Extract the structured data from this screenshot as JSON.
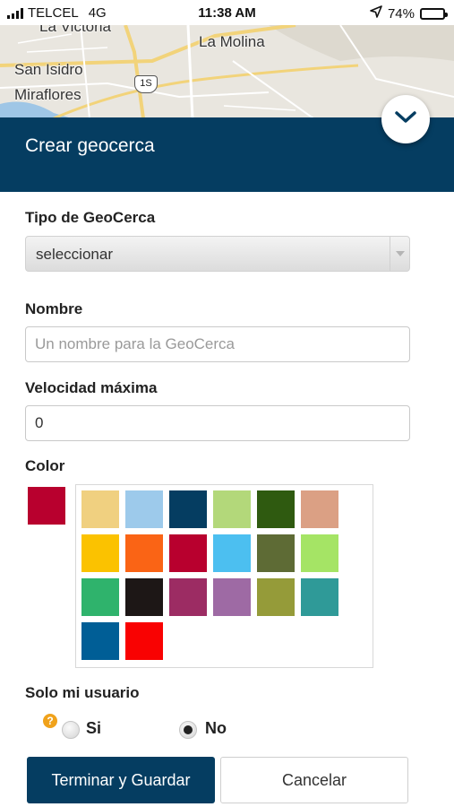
{
  "status": {
    "carrier": "TELCEL",
    "network": "4G",
    "time": "11:38 AM",
    "battery": "74%",
    "battery_level": 0.74
  },
  "map": {
    "labels": [
      "La Victoria",
      "La Molina",
      "San Isidro",
      "Miraflores",
      "1S"
    ]
  },
  "header": {
    "title": "Crear geocerca"
  },
  "form": {
    "tipo_label": "Tipo de GeoCerca",
    "tipo_value": "seleccionar",
    "nombre_label": "Nombre",
    "nombre_placeholder": "Un nombre para la GeoCerca",
    "nombre_value": "",
    "velocidad_label": "Velocidad máxima",
    "velocidad_value": "0",
    "color_label": "Color",
    "selected_color": "#b8002e",
    "palette": [
      "#f0d080",
      "#9dcaeb",
      "#053d61",
      "#b3d87a",
      "#2f5a10",
      "#dba084",
      "#fbc200",
      "#fa6415",
      "#b8002e",
      "#4cbff0",
      "#5e6b35",
      "#a5e465",
      "#2fb36c",
      "#1d1716",
      "#9c2c63",
      "#9e6aa4",
      "#959b39",
      "#2f9a98",
      "#005e96",
      "#f90202"
    ],
    "solo_label": "Solo mi usuario",
    "help_icon": "?",
    "option_si": "Si",
    "option_no": "No",
    "selected_option": "No"
  },
  "actions": {
    "save_label": "Terminar y Guardar",
    "cancel_label": "Cancelar"
  }
}
